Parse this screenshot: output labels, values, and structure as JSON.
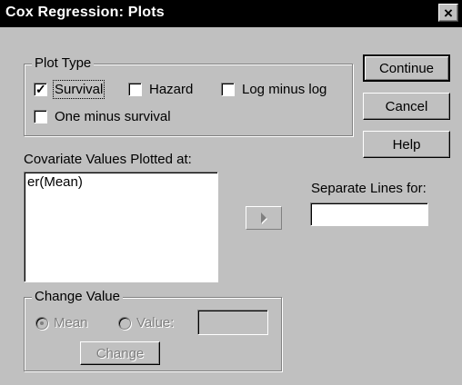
{
  "window": {
    "title": "Cox Regression: Plots"
  },
  "plot_type": {
    "legend": "Plot Type",
    "survival": {
      "label": "Survival",
      "checked": true
    },
    "hazard": {
      "label": "Hazard",
      "checked": false
    },
    "log_minus_log": {
      "label": "Log minus log",
      "checked": false
    },
    "one_minus_survival": {
      "label": "One minus survival",
      "checked": false
    }
  },
  "buttons": {
    "continue": "Continue",
    "cancel": "Cancel",
    "help": "Help"
  },
  "covariates": {
    "label": "Covariate Values Plotted at:",
    "items": [
      "er(Mean)"
    ]
  },
  "separate_lines": {
    "label": "Separate Lines for:",
    "value": ""
  },
  "change_value": {
    "legend": "Change Value",
    "mean_label": "Mean",
    "value_label": "Value:",
    "value_input": "",
    "change_button": "Change"
  }
}
